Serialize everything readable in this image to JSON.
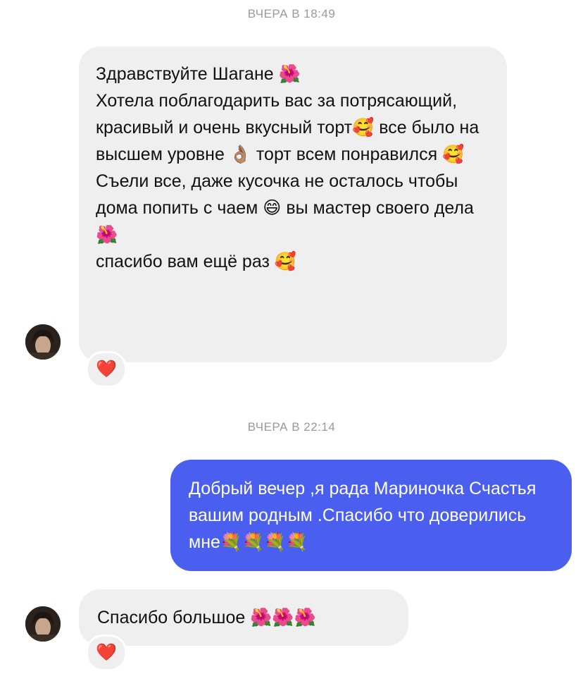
{
  "conversation": {
    "timestamps": [
      "ВЧЕРА В 18:49",
      "ВЧЕРА В 22:14"
    ],
    "messages": [
      {
        "direction": "received",
        "text": "Здравствуйте Шагане 🌺\nХотела поблагодарить вас за потрясающий, красивый и очень вкусный торт🥰 все было на высшем уровне 👌🏽 торт всем понравился 🥰\nСъели все, даже кусочка не осталось чтобы дома попить с чаем 😄 вы мастер своего дела 🌺\nспасибо вам ещё раз 🥰",
        "reaction": "❤️"
      },
      {
        "direction": "sent",
        "text": "Добрый вечер ,я рада Мариночка Счастья вашим родным .Спасибо что доверились мне💐💐💐💐"
      },
      {
        "direction": "received",
        "text": "Спасибо большое 🌺🌺🌺",
        "reaction": "❤️"
      }
    ]
  },
  "colors": {
    "received_bubble": "#efefef",
    "sent_bubble": "#4a5ff0",
    "timestamp": "#9a9a9a",
    "heart": "#e0163c"
  }
}
